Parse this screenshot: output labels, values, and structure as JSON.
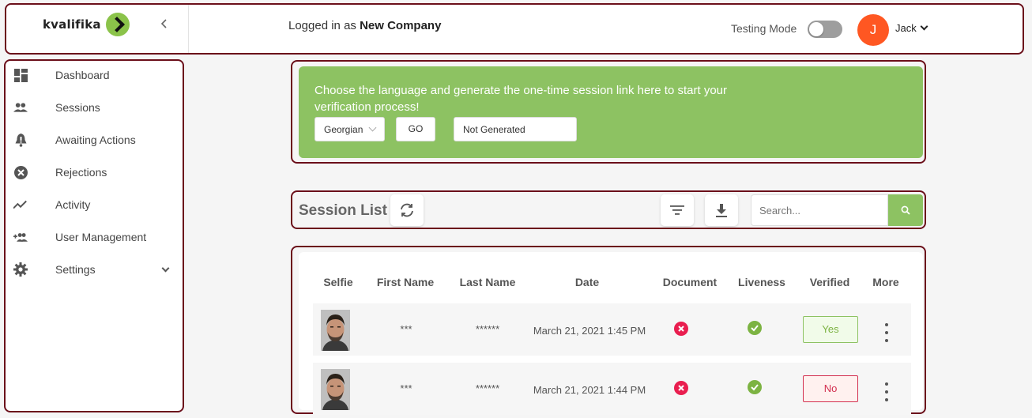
{
  "topbar": {
    "logo_text": "kvalifika",
    "login_prefix": "Logged in as",
    "company": "New Company",
    "testing_label": "Testing Mode",
    "testing_on": false,
    "avatar_initial": "J",
    "user_name": "Jack"
  },
  "sidebar": {
    "items": [
      {
        "label": "Dashboard",
        "icon": "dashboard-icon"
      },
      {
        "label": "Sessions",
        "icon": "people-icon"
      },
      {
        "label": "Awaiting Actions",
        "icon": "bell-alert-icon"
      },
      {
        "label": "Rejections",
        "icon": "cancel-circle-icon"
      },
      {
        "label": "Activity",
        "icon": "trend-icon"
      },
      {
        "label": "User Management",
        "icon": "add-user-icon"
      },
      {
        "label": "Settings",
        "icon": "gear-icon"
      }
    ]
  },
  "promo": {
    "text": "Choose the language and generate the one-time session link here to start your verification process!",
    "language": "Georgian",
    "go_label": "GO",
    "link_value": "Not Generated"
  },
  "session_list": {
    "title": "Session List",
    "search_placeholder": "Search..."
  },
  "table": {
    "headers": [
      "Selfie",
      "First Name",
      "Last Name",
      "Date",
      "Document",
      "Liveness",
      "Verified",
      "More"
    ],
    "rows": [
      {
        "first_name": "***",
        "last_name": "******",
        "date": "March 21, 2021 1:45 PM",
        "document": "fail",
        "liveness": "pass",
        "verified": "Yes"
      },
      {
        "first_name": "***",
        "last_name": "******",
        "date": "March 21, 2021 1:44 PM",
        "document": "fail",
        "liveness": "pass",
        "verified": "No"
      }
    ]
  },
  "colors": {
    "brand_green": "#8dc262",
    "outline": "#6b0f1a",
    "avatar": "#ff5722",
    "fail_red": "#e91e4f",
    "pass_green": "#7cb342"
  }
}
